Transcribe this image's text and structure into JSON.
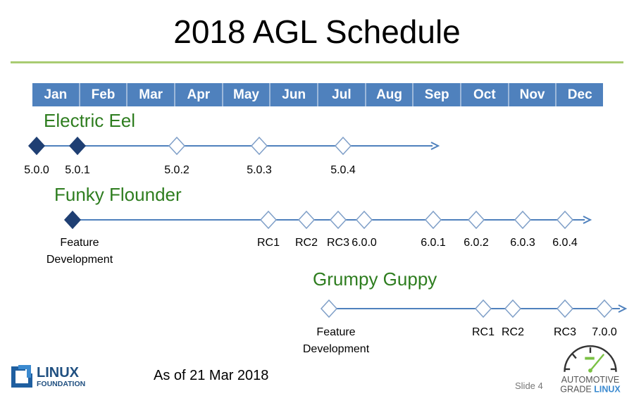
{
  "title": "2018 AGL Schedule",
  "months": [
    "Jan",
    "Feb",
    "Mar",
    "Apr",
    "May",
    "Jun",
    "Jul",
    "Aug",
    "Sep",
    "Oct",
    "Nov",
    "Dec"
  ],
  "releases": [
    {
      "name": "Electric Eel",
      "milestones": [
        {
          "label": "5.0.0",
          "filled": true
        },
        {
          "label": "5.0.1",
          "filled": true
        },
        {
          "label": "5.0.2",
          "filled": false
        },
        {
          "label": "5.0.3",
          "filled": false
        },
        {
          "label": "5.0.4",
          "filled": false
        }
      ]
    },
    {
      "name": "Funky Flounder",
      "milestones": [
        {
          "label": "Feature Development",
          "filled": true
        },
        {
          "label": "RC1",
          "filled": false
        },
        {
          "label": "RC2",
          "filled": false
        },
        {
          "label": "RC3",
          "filled": false
        },
        {
          "label": "6.0.0",
          "filled": false
        },
        {
          "label": "6.0.1",
          "filled": false
        },
        {
          "label": "6.0.2",
          "filled": false
        },
        {
          "label": "6.0.3",
          "filled": false
        },
        {
          "label": "6.0.4",
          "filled": false
        }
      ]
    },
    {
      "name": "Grumpy Guppy",
      "milestones": [
        {
          "label": "Feature Development",
          "filled": false
        },
        {
          "label": "RC1",
          "filled": false
        },
        {
          "label": "RC2",
          "filled": false
        },
        {
          "label": "RC3",
          "filled": false
        },
        {
          "label": "7.0.0",
          "filled": false
        }
      ]
    }
  ],
  "footer": {
    "as_of": "As of 21 Mar 2018",
    "slide_number": "Slide 4",
    "linux_foundation_logo": "LINUX FOUNDATION",
    "agl_logo": "AUTOMOTIVE GRADE LINUX"
  },
  "colors": {
    "month_bar": "#4f81bd",
    "release_name": "#2e7d1f",
    "timeline": "#4f81bd",
    "filled_diamond": "#1f3f73",
    "title_rule": "#a9cc72"
  }
}
